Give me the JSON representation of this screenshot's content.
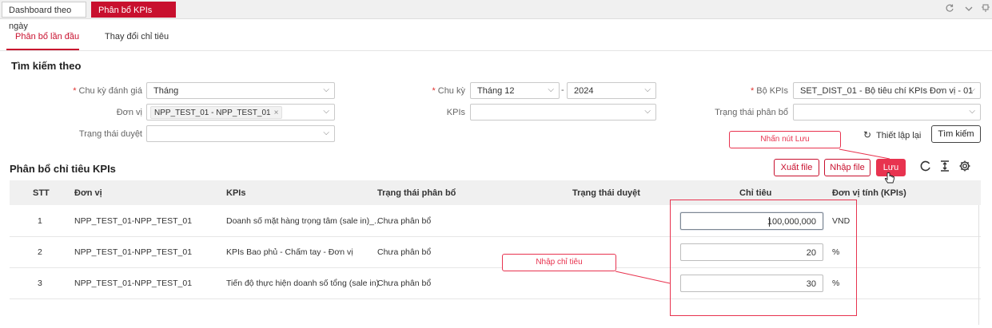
{
  "top_tabs": [
    {
      "label": "Dashboard theo ngày"
    },
    {
      "label": "Phân bổ KPIs đơn vị",
      "close": "×"
    }
  ],
  "top_icons": [
    "refresh-icon",
    "chevron-down-icon",
    "pin-icon"
  ],
  "sub_tabs": [
    {
      "label": "Phân bổ lần đầu",
      "active": true
    },
    {
      "label": "Thay đổi chỉ tiêu",
      "active": false
    }
  ],
  "search": {
    "title": "Tìm kiếm theo",
    "fields": {
      "chu_ky_danh_gia": {
        "label": "Chu kỳ đánh giá",
        "required": "*",
        "value": "Tháng"
      },
      "chu_ky": {
        "label": "Chu kỳ",
        "required": "*",
        "month": "Tháng 12",
        "separator": "-",
        "year": "2024"
      },
      "bo_kpis": {
        "label": "Bộ KPIs",
        "required": "*",
        "value": "SET_DIST_01 - Bộ tiêu chí KPIs Đơn vị - 01"
      },
      "don_vi": {
        "label": "Đơn vị",
        "chip": "NPP_TEST_01 - NPP_TEST_01",
        "chip_close": "×"
      },
      "kpis": {
        "label": "KPIs",
        "value": ""
      },
      "trang_thai_phan_bo": {
        "label": "Trạng thái phân bổ",
        "value": ""
      },
      "trang_thai_duyet": {
        "label": "Trạng thái duyệt",
        "value": ""
      }
    },
    "reset_label": "Thiết lập lại",
    "search_label": "Tìm kiếm"
  },
  "table_section": {
    "title": "Phân bổ chỉ tiêu KPIs",
    "buttons": {
      "export": "Xuất file",
      "import": "Nhập file",
      "save": "Lưu"
    },
    "tool_icons": [
      "reload-icon",
      "column-height-icon",
      "settings-icon"
    ],
    "columns": [
      "STT",
      "Đơn vị",
      "KPIs",
      "Trạng thái phân bổ",
      "Trạng thái duyệt",
      "Chỉ tiêu",
      "Đơn vị tính (KPIs)"
    ],
    "rows": [
      {
        "stt": "1",
        "don_vi": "NPP_TEST_01-NPP_TEST_01",
        "kpis": "Doanh số mặt hàng trọng tâm (sale in)_...",
        "trang_thai_phan_bo": "Chưa phân bổ",
        "trang_thai_duyet": "",
        "chi_tieu": "100,000,000",
        "don_vi_tinh": "VND"
      },
      {
        "stt": "2",
        "don_vi": "NPP_TEST_01-NPP_TEST_01",
        "kpis": "KPIs Bao phủ - Chấm tay - Đơn vị",
        "trang_thai_phan_bo": "Chưa phân bổ",
        "trang_thai_duyet": "",
        "chi_tieu": "20",
        "don_vi_tinh": "%"
      },
      {
        "stt": "3",
        "don_vi": "NPP_TEST_01-NPP_TEST_01",
        "kpis": "Tiến độ thực hiện doanh số tổng (sale in)",
        "trang_thai_phan_bo": "Chưa phân bổ",
        "trang_thai_duyet": "",
        "chi_tieu": "30",
        "don_vi_tinh": "%"
      }
    ]
  },
  "annotations": {
    "save_hint": "Nhấn nút Lưu",
    "input_hint": "Nhập chỉ tiêu"
  },
  "colors": {
    "brand": "#c8102e",
    "save_button": "#e8334f",
    "annotation": "#e8334f"
  }
}
